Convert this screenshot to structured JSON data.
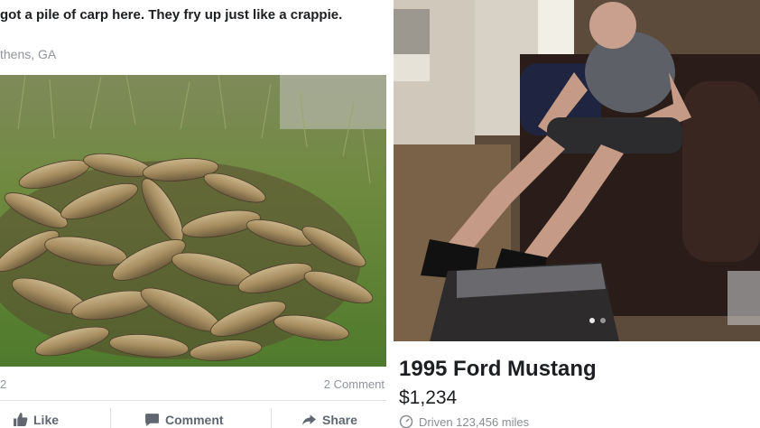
{
  "post": {
    "text": "got a pile of carp here. They fry up just like a crappie.",
    "location": "thens, GA",
    "likes_count": "2",
    "comments_count": "2 Comment",
    "actions": {
      "like": "Like",
      "comment": "Comment",
      "share": "Share"
    },
    "icons": [
      "thumbs-up-icon",
      "comment-icon",
      "share-icon"
    ]
  },
  "listing": {
    "title": "1995 Ford Mustang",
    "price": "$1,234",
    "driven": "Driven 123,456 miles",
    "carousel": {
      "total": 2,
      "active": 1
    },
    "icons": [
      "speedometer-icon"
    ]
  },
  "colors": {
    "text": "#1c1e21",
    "muted": "#90949c",
    "action": "#606770",
    "border": "#dddfe2"
  }
}
